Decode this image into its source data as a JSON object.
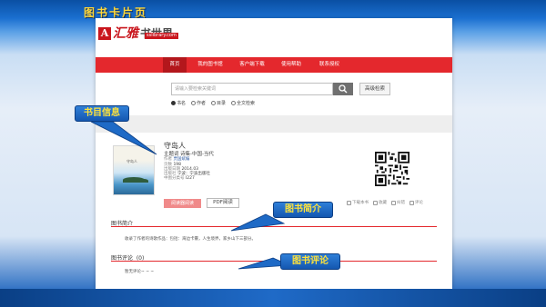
{
  "slide": {
    "title": "图书卡片页"
  },
  "site": {
    "logo_mark": "A",
    "logo_name": "汇雅",
    "logo_suffix": "书世界",
    "logo_url": "sslibrary.com"
  },
  "nav": {
    "items": [
      "首页",
      "我的图书馆",
      "客户端下载",
      "使用帮助",
      "联系授权"
    ],
    "active_index": 0
  },
  "search": {
    "placeholder": "请输入要检索关键词",
    "button_icon": "search-icon",
    "advanced_label": "高级检索",
    "options": [
      "书名",
      "作者",
      "目录",
      "全文检索"
    ],
    "selected_option": "书名"
  },
  "book": {
    "cover_title": "守岛人",
    "title": "守岛人",
    "subject_label": "主题词",
    "subject_value": "诗集-中国-当代",
    "author_label": "作者",
    "author_value": "贾国斌编",
    "pages_label": "页数",
    "pages_value": "198",
    "date_label": "出版日期",
    "date_value": "2014.03",
    "publisher_label": "出版社",
    "publisher_value": "宁波：宁波出版社",
    "class_label": "中图分类号",
    "class_value": "I227",
    "read_button": "阅读器阅读",
    "pdf_button": "PDF阅读",
    "actions": [
      "下载本书",
      "收藏",
      "纠错",
      "评论"
    ]
  },
  "sections": {
    "intro_title": "图书简介",
    "intro_text": "收录了作者的诗歌作品：包括：海边卡霎，人生境界，家乡山下三部分。",
    "review_title": "图书评论",
    "review_count": "(0)",
    "review_text": "暂无评论~ ~ ~"
  },
  "callouts": {
    "info": "书目信息",
    "intro": "图书简介",
    "review": "图书评论"
  },
  "colors": {
    "brand_red": "#e4282d",
    "callout_blue": "#1e6ac6",
    "callout_text": "#ffe23a",
    "slide_title": "#ffd83a"
  }
}
